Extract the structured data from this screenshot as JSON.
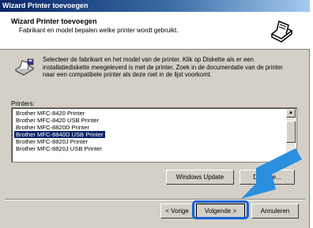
{
  "window": {
    "title": "Wizard Printer toevoegen"
  },
  "header": {
    "title": "Wizard Printer toevoegen",
    "subtitle": "Fabrikant en model bepalen welke printer wordt gebruikt.",
    "icon": "printer-icon"
  },
  "info": {
    "icon": "printer-disk-icon",
    "lines": [
      "Selecteer de fabrikant en het model van de printer. Klik op Diskette als er een",
      "installatiediskette meegeleverd is met de printer. Zoek in de documentatie van de printer",
      "naar een compatibele printer als deze niet in de lijst voorkomt."
    ]
  },
  "printers": {
    "label": "Printers:",
    "items": [
      "Brother MFC-8420 Printer",
      "Brother MFC-8420 USB Printer",
      "Brother MFC-8820D Printer",
      "Brother MFC-8840D USB Printer",
      "Brother MFC-8820J Printer",
      "Brother MFC-8820J USB Printer"
    ],
    "selected_index": 3
  },
  "buttons": {
    "windows_update": "Windows Update",
    "disk": "Diskette...",
    "back": "< Vorige",
    "next": "Volgende >",
    "cancel": "Annuleren"
  },
  "colors": {
    "selection": "#0a246a",
    "highlight": "#1560d4",
    "arrow": "#2a8fe0"
  }
}
